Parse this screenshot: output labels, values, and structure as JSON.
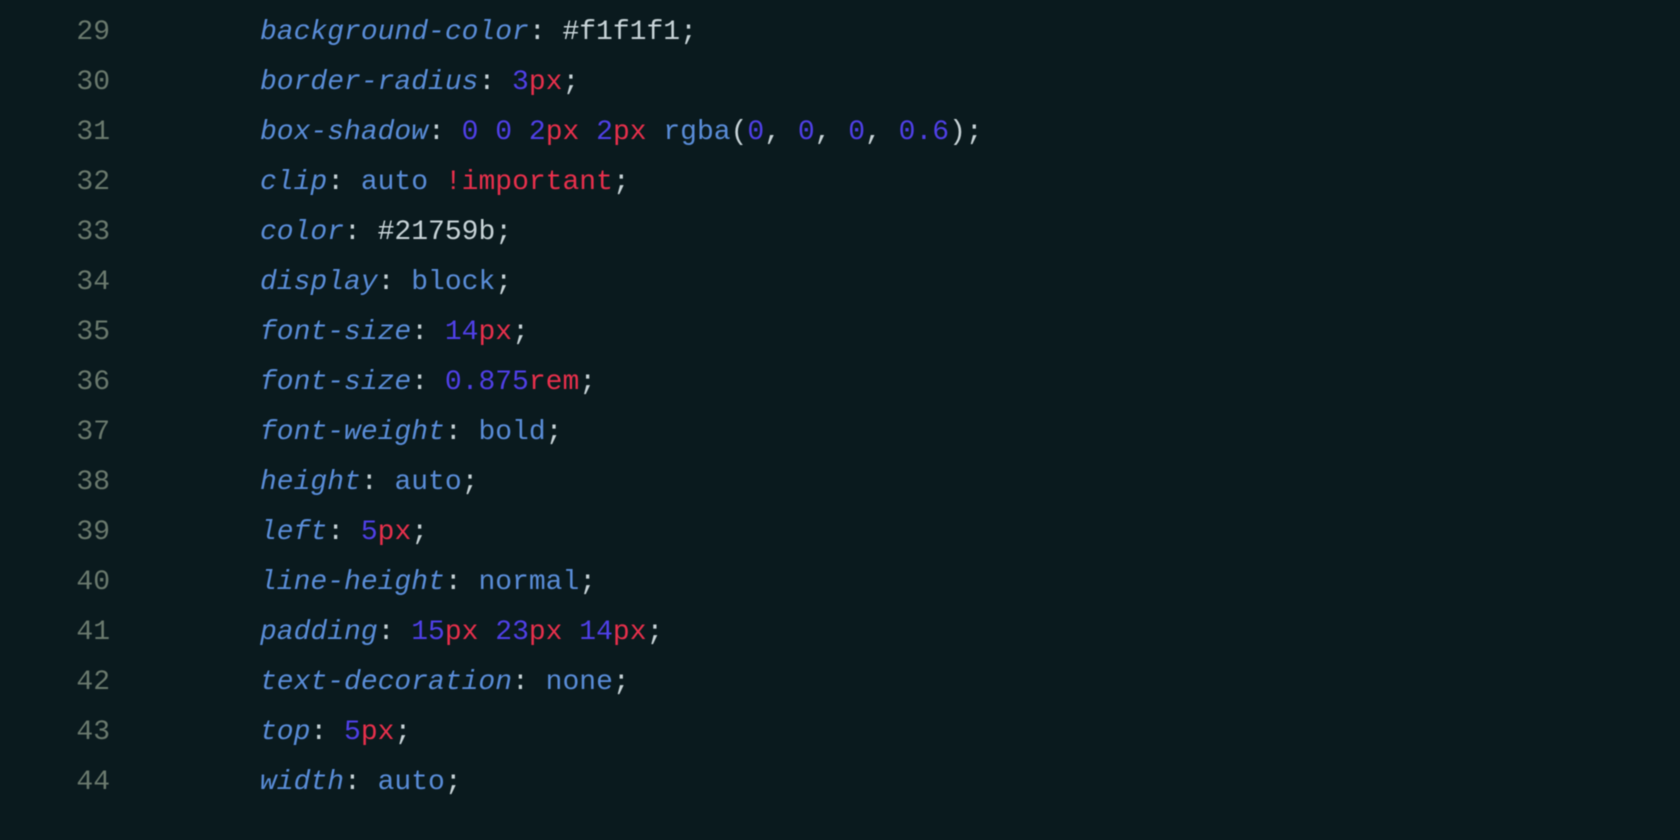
{
  "lines": [
    {
      "n": "29",
      "tokens": [
        {
          "t": "prop",
          "v": "background-color"
        },
        {
          "t": "punct",
          "v": ": "
        },
        {
          "t": "hex",
          "v": "#f1f1f1"
        },
        {
          "t": "punct",
          "v": ";"
        }
      ]
    },
    {
      "n": "30",
      "tokens": [
        {
          "t": "prop",
          "v": "border-radius"
        },
        {
          "t": "punct",
          "v": ": "
        },
        {
          "t": "num",
          "v": "3"
        },
        {
          "t": "unit",
          "v": "px"
        },
        {
          "t": "punct",
          "v": ";"
        }
      ]
    },
    {
      "n": "31",
      "tokens": [
        {
          "t": "prop",
          "v": "box-shadow"
        },
        {
          "t": "punct",
          "v": ": "
        },
        {
          "t": "num",
          "v": "0"
        },
        {
          "t": "punct",
          "v": " "
        },
        {
          "t": "num",
          "v": "0"
        },
        {
          "t": "punct",
          "v": " "
        },
        {
          "t": "num",
          "v": "2"
        },
        {
          "t": "unit",
          "v": "px"
        },
        {
          "t": "punct",
          "v": " "
        },
        {
          "t": "num",
          "v": "2"
        },
        {
          "t": "unit",
          "v": "px"
        },
        {
          "t": "punct",
          "v": " "
        },
        {
          "t": "func",
          "v": "rgba"
        },
        {
          "t": "paren",
          "v": "("
        },
        {
          "t": "num",
          "v": "0"
        },
        {
          "t": "punct",
          "v": ", "
        },
        {
          "t": "num",
          "v": "0"
        },
        {
          "t": "punct",
          "v": ", "
        },
        {
          "t": "num",
          "v": "0"
        },
        {
          "t": "punct",
          "v": ", "
        },
        {
          "t": "num",
          "v": "0.6"
        },
        {
          "t": "paren",
          "v": ")"
        },
        {
          "t": "punct",
          "v": ";"
        }
      ]
    },
    {
      "n": "32",
      "tokens": [
        {
          "t": "prop",
          "v": "clip"
        },
        {
          "t": "punct",
          "v": ": "
        },
        {
          "t": "kw",
          "v": "auto"
        },
        {
          "t": "punct",
          "v": " "
        },
        {
          "t": "important",
          "v": "!important"
        },
        {
          "t": "punct",
          "v": ";"
        }
      ]
    },
    {
      "n": "33",
      "tokens": [
        {
          "t": "prop",
          "v": "color"
        },
        {
          "t": "punct",
          "v": ": "
        },
        {
          "t": "hex",
          "v": "#21759b"
        },
        {
          "t": "punct",
          "v": ";"
        }
      ]
    },
    {
      "n": "34",
      "tokens": [
        {
          "t": "prop",
          "v": "display"
        },
        {
          "t": "punct",
          "v": ": "
        },
        {
          "t": "kw",
          "v": "block"
        },
        {
          "t": "punct",
          "v": ";"
        }
      ]
    },
    {
      "n": "35",
      "tokens": [
        {
          "t": "prop",
          "v": "font-size"
        },
        {
          "t": "punct",
          "v": ": "
        },
        {
          "t": "num",
          "v": "14"
        },
        {
          "t": "unit",
          "v": "px"
        },
        {
          "t": "punct",
          "v": ";"
        }
      ]
    },
    {
      "n": "36",
      "tokens": [
        {
          "t": "prop",
          "v": "font-size"
        },
        {
          "t": "punct",
          "v": ": "
        },
        {
          "t": "num",
          "v": "0.875"
        },
        {
          "t": "unit",
          "v": "rem"
        },
        {
          "t": "punct",
          "v": ";"
        }
      ]
    },
    {
      "n": "37",
      "tokens": [
        {
          "t": "prop",
          "v": "font-weight"
        },
        {
          "t": "punct",
          "v": ": "
        },
        {
          "t": "kw",
          "v": "bold"
        },
        {
          "t": "punct",
          "v": ";"
        }
      ]
    },
    {
      "n": "38",
      "tokens": [
        {
          "t": "prop",
          "v": "height"
        },
        {
          "t": "punct",
          "v": ": "
        },
        {
          "t": "kw",
          "v": "auto"
        },
        {
          "t": "punct",
          "v": ";"
        }
      ]
    },
    {
      "n": "39",
      "tokens": [
        {
          "t": "prop",
          "v": "left"
        },
        {
          "t": "punct",
          "v": ": "
        },
        {
          "t": "num",
          "v": "5"
        },
        {
          "t": "unit",
          "v": "px"
        },
        {
          "t": "punct",
          "v": ";"
        }
      ]
    },
    {
      "n": "40",
      "tokens": [
        {
          "t": "prop",
          "v": "line-height"
        },
        {
          "t": "punct",
          "v": ": "
        },
        {
          "t": "kw",
          "v": "normal"
        },
        {
          "t": "punct",
          "v": ";"
        }
      ]
    },
    {
      "n": "41",
      "tokens": [
        {
          "t": "prop",
          "v": "padding"
        },
        {
          "t": "punct",
          "v": ": "
        },
        {
          "t": "num",
          "v": "15"
        },
        {
          "t": "unit",
          "v": "px"
        },
        {
          "t": "punct",
          "v": " "
        },
        {
          "t": "num",
          "v": "23"
        },
        {
          "t": "unit",
          "v": "px"
        },
        {
          "t": "punct",
          "v": " "
        },
        {
          "t": "num",
          "v": "14"
        },
        {
          "t": "unit",
          "v": "px"
        },
        {
          "t": "punct",
          "v": ";"
        }
      ]
    },
    {
      "n": "42",
      "tokens": [
        {
          "t": "prop",
          "v": "text-decoration"
        },
        {
          "t": "punct",
          "v": ": "
        },
        {
          "t": "kw",
          "v": "none"
        },
        {
          "t": "punct",
          "v": ";"
        }
      ]
    },
    {
      "n": "43",
      "tokens": [
        {
          "t": "prop",
          "v": "top"
        },
        {
          "t": "punct",
          "v": ": "
        },
        {
          "t": "num",
          "v": "5"
        },
        {
          "t": "unit",
          "v": "px"
        },
        {
          "t": "punct",
          "v": ";"
        }
      ]
    },
    {
      "n": "44",
      "tokens": [
        {
          "t": "prop",
          "v": "width"
        },
        {
          "t": "punct",
          "v": ": "
        },
        {
          "t": "kw",
          "v": "auto"
        },
        {
          "t": "punct",
          "v": ";"
        }
      ]
    }
  ]
}
